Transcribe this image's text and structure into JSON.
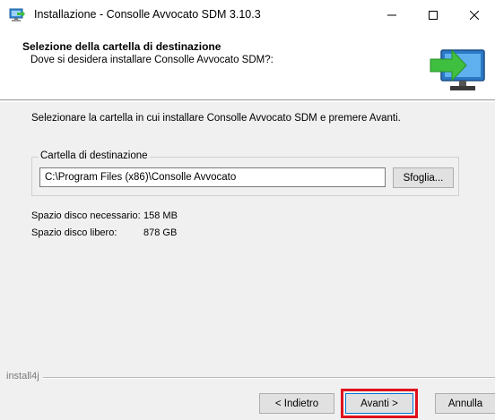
{
  "window": {
    "title": "Installazione - Consolle Avvocato SDM 3.10.3",
    "icon": "installer-computer-icon"
  },
  "header": {
    "title": "Selezione della cartella di destinazione",
    "subtitle": "Dove si desidera installare Consolle Avvocato SDM?:"
  },
  "main": {
    "instruction": "Selezionare la cartella in cui installare Consolle Avvocato SDM e premere Avanti.",
    "destination_group": {
      "legend": "Cartella di destinazione",
      "path_value": "C:\\Program Files (x86)\\Consolle Avvocato",
      "browse_label": "Sfoglia..."
    },
    "disk_space": [
      {
        "label": "Spazio disco necessario:",
        "value": "158 MB"
      },
      {
        "label": "Spazio disco libero:",
        "value": "878 GB"
      }
    ]
  },
  "footer": {
    "brand": "install4j",
    "back_label": "< Indietro",
    "next_label": "Avanti >",
    "cancel_label": "Annulla"
  },
  "colors": {
    "highlight": "#e0111a",
    "arrow_green": "#3fbf3f",
    "monitor_blue": "#2b78c5"
  }
}
